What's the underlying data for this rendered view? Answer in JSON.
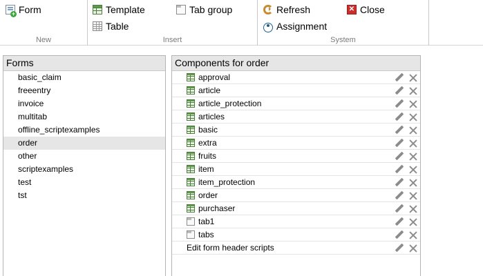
{
  "ribbon": {
    "groups": {
      "new": {
        "label": "New",
        "form_label": "Form"
      },
      "insert": {
        "label": "Insert",
        "template_label": "Template",
        "tab_group_label": "Tab group",
        "table_label": "Table"
      },
      "system": {
        "label": "System",
        "refresh_label": "Refresh",
        "close_label": "Close",
        "assignment_label": "Assignment"
      }
    }
  },
  "forms_panel": {
    "title": "Forms",
    "selected": "order",
    "items": [
      "basic_claim",
      "freeentry",
      "invoice",
      "multitab",
      "offline_scriptexamples",
      "order",
      "other",
      "scriptexamples",
      "test",
      "tst"
    ]
  },
  "components_panel": {
    "title": "Components for order",
    "items": [
      {
        "label": "approval",
        "icon": "template-icon"
      },
      {
        "label": "article",
        "icon": "template-icon"
      },
      {
        "label": "article_protection",
        "icon": "template-icon"
      },
      {
        "label": "articles",
        "icon": "template-icon"
      },
      {
        "label": "basic",
        "icon": "template-icon"
      },
      {
        "label": "extra",
        "icon": "template-icon"
      },
      {
        "label": "fruits",
        "icon": "template-icon"
      },
      {
        "label": "item",
        "icon": "template-icon"
      },
      {
        "label": "item_protection",
        "icon": "template-icon"
      },
      {
        "label": "order",
        "icon": "template-icon"
      },
      {
        "label": "purchaser",
        "icon": "template-icon"
      },
      {
        "label": "tab1",
        "icon": "tab-group-icon"
      },
      {
        "label": "tabs",
        "icon": "tab-group-icon"
      }
    ],
    "footer_item": "Edit form header scripts"
  }
}
